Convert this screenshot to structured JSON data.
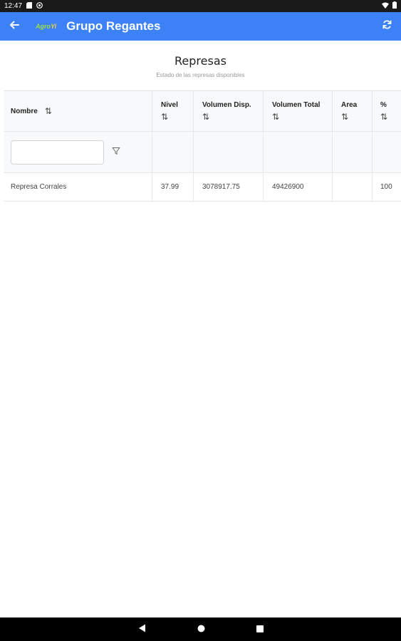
{
  "status_bar": {
    "time": "12:47"
  },
  "app_bar": {
    "logo": {
      "agro": "Agro",
      "yi": "Yi"
    },
    "title": "Grupo Regantes"
  },
  "page": {
    "title": "Represas",
    "subtitle": "Estado de las represas disponibles"
  },
  "table": {
    "columns": [
      "Nombre",
      "Nivel",
      "Volumen Disp.",
      "Volumen Total",
      "Area",
      "%"
    ],
    "rows": [
      [
        "Represa Corrales",
        "37.99",
        "3078917.75",
        "49426900",
        "",
        "100"
      ]
    ],
    "filter_placeholder": ""
  },
  "colors": {
    "app_bar": "#3c82f6",
    "status_bar": "#1a1a1a",
    "nav_bar": "#000000"
  }
}
